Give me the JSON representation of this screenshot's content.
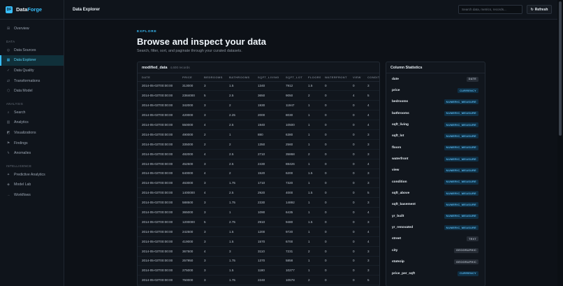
{
  "app": {
    "logo_glyph": "DF",
    "name_prefix": "Data",
    "name_accent": "Forge"
  },
  "sidebar": {
    "top_items": [
      {
        "id": "overview",
        "label": "Overview",
        "icon": "grid-icon",
        "glyph": "⊞",
        "active": false
      }
    ],
    "sections": [
      {
        "title": "DATA",
        "items": [
          {
            "id": "data-sources",
            "label": "Data Sources",
            "icon": "database-icon",
            "glyph": "◎",
            "active": false
          },
          {
            "id": "data-explorer",
            "label": "Data Explorer",
            "icon": "table-icon",
            "glyph": "▦",
            "active": true
          },
          {
            "id": "data-quality",
            "label": "Data Quality",
            "icon": "check-icon",
            "glyph": "✓",
            "active": false
          },
          {
            "id": "transformations",
            "label": "Transformations",
            "icon": "transform-icon",
            "glyph": "⇄",
            "active": false
          },
          {
            "id": "data-model",
            "label": "Data Model",
            "icon": "model-icon",
            "glyph": "⬡",
            "active": false
          }
        ]
      },
      {
        "title": "ANALYSIS",
        "items": [
          {
            "id": "search",
            "label": "Search",
            "icon": "search-icon",
            "glyph": "⌕",
            "active": false
          },
          {
            "id": "analytics",
            "label": "Analytics",
            "icon": "analytics-icon",
            "glyph": "▥",
            "active": false
          },
          {
            "id": "visualizations",
            "label": "Visualizations",
            "icon": "chart-icon",
            "glyph": "◩",
            "active": false
          },
          {
            "id": "findings",
            "label": "Findings",
            "icon": "flag-icon",
            "glyph": "⚑",
            "active": false
          },
          {
            "id": "anomalies",
            "label": "Anomalies",
            "icon": "lightning-icon",
            "glyph": "ϟ",
            "active": false
          }
        ]
      },
      {
        "title": "INTELLIGENCE",
        "items": [
          {
            "id": "predictive-analytics",
            "label": "Predictive Analytics",
            "icon": "sparkle-icon",
            "glyph": "✦",
            "active": false
          },
          {
            "id": "model-lab",
            "label": "Model Lab",
            "icon": "lab-icon",
            "glyph": "◈",
            "active": false
          },
          {
            "id": "workflows",
            "label": "Workflows",
            "icon": "workflow-icon",
            "glyph": "→",
            "active": false
          }
        ]
      }
    ]
  },
  "topbar": {
    "title": "Data Explorer",
    "search_placeholder": "Search data, metrics, records...",
    "refresh_glyph": "↻",
    "refresh_label": "Refresh"
  },
  "main": {
    "eyebrow": "EXPLORE",
    "title": "Browse and inspect your data",
    "subtitle": "Search, filter, sort, and paginate through your curated datasets."
  },
  "table": {
    "dataset_name": "modified_data",
    "record_count": "4,600 records",
    "columns": [
      "DATE",
      "PRICE",
      "BEDROOMS",
      "BATHROOMS",
      "SQFT_LIVING",
      "SQFT_LOT",
      "FLOORS",
      "WATERFRONT",
      "VIEW",
      "CONDITI"
    ],
    "rows": [
      [
        "2014-05-02T00:00:00",
        "313000",
        "3",
        "1.5",
        "1340",
        "7912",
        "1.5",
        "0",
        "0",
        "3"
      ],
      [
        "2014-05-02T00:00:00",
        "2384000",
        "5",
        "2.5",
        "3650",
        "9050",
        "2",
        "0",
        "4",
        "5"
      ],
      [
        "2014-05-02T00:00:00",
        "342000",
        "3",
        "2",
        "1930",
        "11947",
        "1",
        "0",
        "0",
        "4"
      ],
      [
        "2014-05-02T00:00:00",
        "420000",
        "3",
        "2.25",
        "2000",
        "8030",
        "1",
        "0",
        "0",
        "4"
      ],
      [
        "2014-05-02T00:00:00",
        "550000",
        "4",
        "2.5",
        "1940",
        "10500",
        "1",
        "0",
        "0",
        "4"
      ],
      [
        "2014-05-02T00:00:00",
        "490000",
        "2",
        "1",
        "880",
        "6380",
        "1",
        "0",
        "0",
        "3"
      ],
      [
        "2014-05-02T00:00:00",
        "335000",
        "2",
        "2",
        "1350",
        "2560",
        "1",
        "0",
        "0",
        "3"
      ],
      [
        "2014-05-02T00:00:00",
        "482000",
        "4",
        "2.5",
        "2710",
        "35868",
        "2",
        "0",
        "0",
        "3"
      ],
      [
        "2014-05-02T00:00:00",
        "452500",
        "3",
        "2.5",
        "2430",
        "88426",
        "1",
        "0",
        "0",
        "4"
      ],
      [
        "2014-05-02T00:00:00",
        "640000",
        "4",
        "2",
        "1520",
        "6200",
        "1.5",
        "0",
        "0",
        "3"
      ],
      [
        "2014-05-02T00:00:00",
        "463000",
        "3",
        "1.75",
        "1710",
        "7320",
        "1",
        "0",
        "0",
        "3"
      ],
      [
        "2014-05-02T00:00:00",
        "1400000",
        "4",
        "2.5",
        "2920",
        "4000",
        "1.5",
        "0",
        "0",
        "5"
      ],
      [
        "2014-05-02T00:00:00",
        "588500",
        "3",
        "1.75",
        "2330",
        "14892",
        "1",
        "0",
        "0",
        "3"
      ],
      [
        "2014-05-02T00:00:00",
        "365000",
        "3",
        "1",
        "1090",
        "6435",
        "1",
        "0",
        "0",
        "4"
      ],
      [
        "2014-05-02T00:00:00",
        "1200000",
        "5",
        "2.75",
        "2910",
        "9480",
        "1.5",
        "0",
        "0",
        "3"
      ],
      [
        "2014-05-02T00:00:00",
        "242500",
        "3",
        "1.5",
        "1200",
        "9720",
        "1",
        "0",
        "0",
        "4"
      ],
      [
        "2014-05-02T00:00:00",
        "419000",
        "3",
        "1.5",
        "1570",
        "6700",
        "1",
        "0",
        "0",
        "4"
      ],
      [
        "2014-05-02T00:00:00",
        "367500",
        "4",
        "3",
        "3110",
        "7231",
        "2",
        "0",
        "0",
        "3"
      ],
      [
        "2014-05-02T00:00:00",
        "257950",
        "3",
        "1.75",
        "1370",
        "5858",
        "1",
        "0",
        "0",
        "3"
      ],
      [
        "2014-05-02T00:00:00",
        "275000",
        "3",
        "1.5",
        "1180",
        "10277",
        "1",
        "0",
        "0",
        "3"
      ],
      [
        "2014-05-02T00:00:00",
        "750000",
        "3",
        "1.75",
        "2240",
        "10578",
        "2",
        "0",
        "0",
        "5"
      ]
    ]
  },
  "stats": {
    "title": "Column Statistics",
    "columns": [
      {
        "name": "date",
        "type": "DATE",
        "kind": "neutral"
      },
      {
        "name": "price",
        "type": "CURRENCY",
        "kind": "blue"
      },
      {
        "name": "bedrooms",
        "type": "NUMERIC_MEASURE",
        "kind": "blue"
      },
      {
        "name": "bathrooms",
        "type": "NUMERIC_MEASURE",
        "kind": "blue"
      },
      {
        "name": "sqft_living",
        "type": "NUMERIC_MEASURE",
        "kind": "blue"
      },
      {
        "name": "sqft_lot",
        "type": "NUMERIC_MEASURE",
        "kind": "blue"
      },
      {
        "name": "floors",
        "type": "NUMERIC_MEASURE",
        "kind": "blue"
      },
      {
        "name": "waterfront",
        "type": "NUMERIC_MEASURE",
        "kind": "blue"
      },
      {
        "name": "view",
        "type": "NUMERIC_MEASURE",
        "kind": "blue"
      },
      {
        "name": "condition",
        "type": "NUMERIC_MEASURE",
        "kind": "blue"
      },
      {
        "name": "sqft_above",
        "type": "NUMERIC_MEASURE",
        "kind": "blue"
      },
      {
        "name": "sqft_basement",
        "type": "NUMERIC_MEASURE",
        "kind": "blue"
      },
      {
        "name": "yr_built",
        "type": "NUMERIC_MEASURE",
        "kind": "blue"
      },
      {
        "name": "yr_renovated",
        "type": "NUMERIC_MEASURE",
        "kind": "blue"
      },
      {
        "name": "street",
        "type": "TEXT",
        "kind": "neutral"
      },
      {
        "name": "city",
        "type": "GEOGRAPHIC",
        "kind": "neutral"
      },
      {
        "name": "statezip",
        "type": "GEOGRAPHIC",
        "kind": "neutral"
      },
      {
        "name": "price_per_sqft",
        "type": "CURRENCY",
        "kind": "blue"
      }
    ]
  },
  "colors": {
    "accent": "#38bdf8",
    "badge_blue_bg": "#0f2f44",
    "badge_blue_fg": "#5ab8f0",
    "badge_neutral_bg": "#262c35",
    "badge_neutral_fg": "#aab2bd"
  }
}
